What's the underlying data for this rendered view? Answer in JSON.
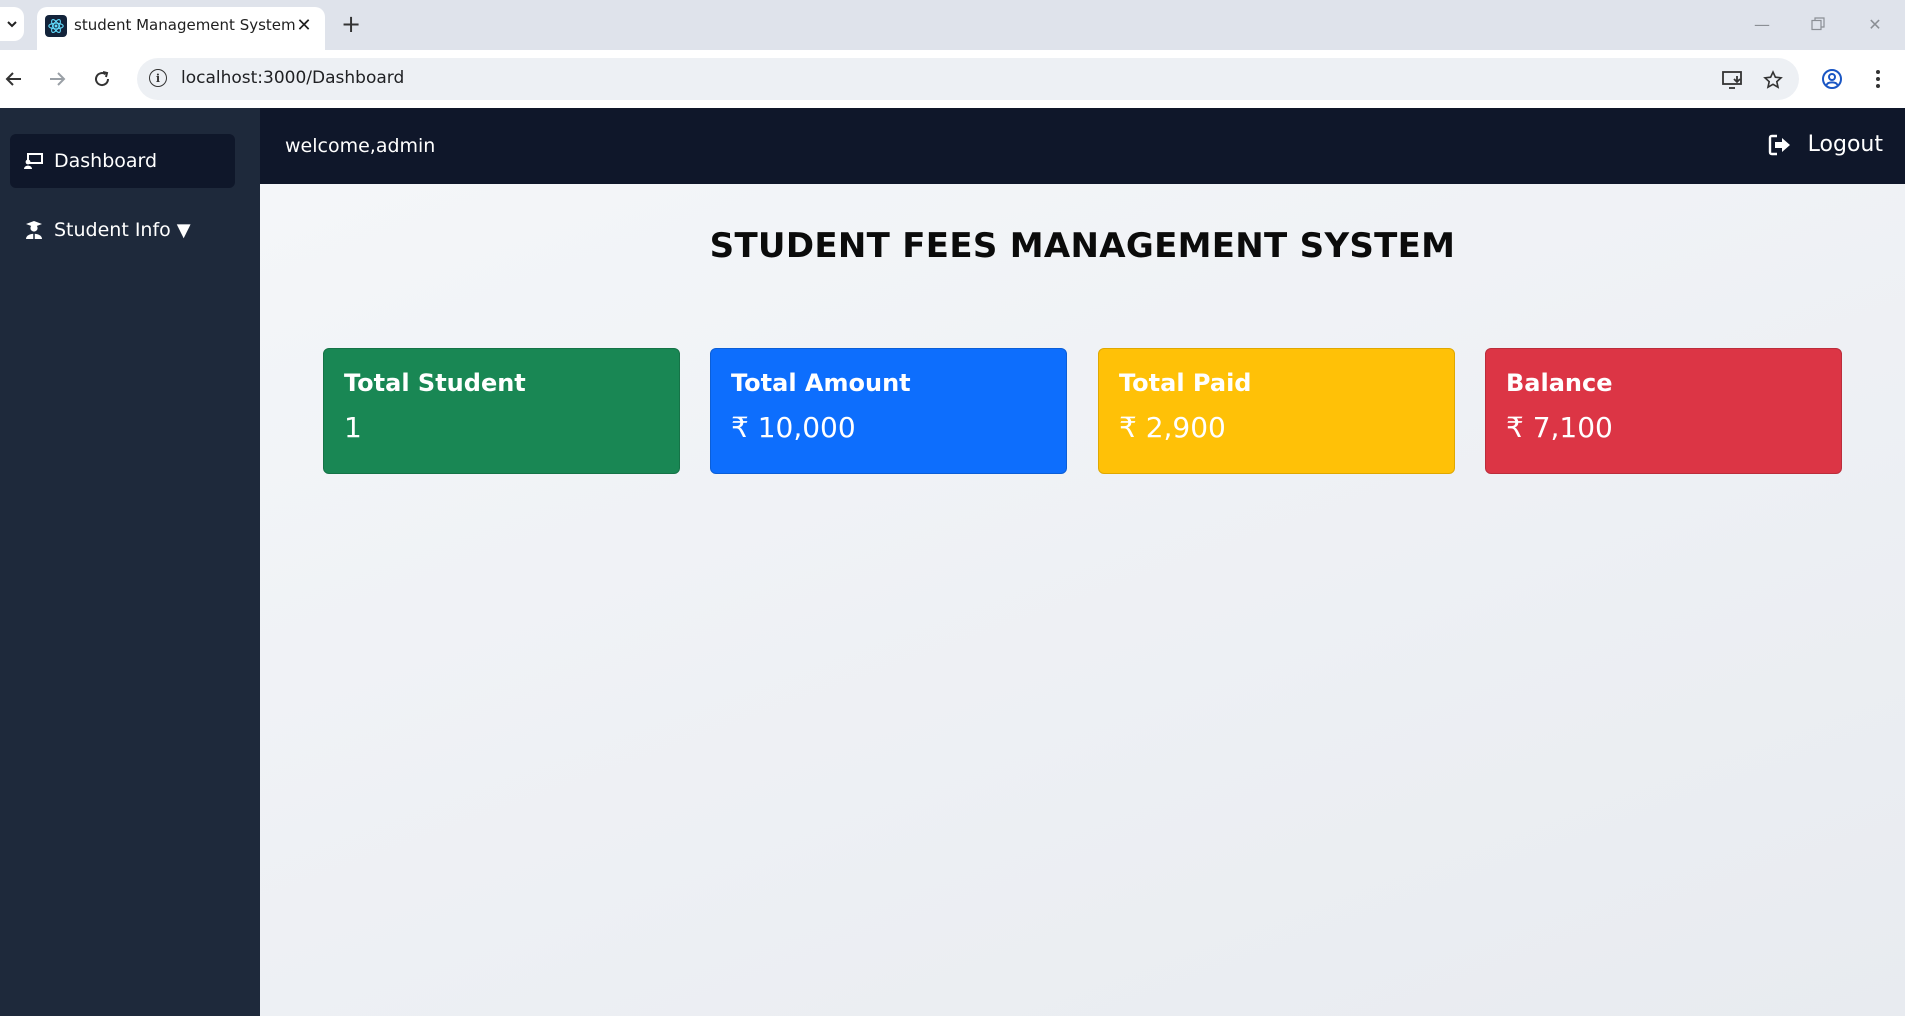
{
  "browser": {
    "tab_title": "student Management System",
    "url": "localhost:3000/Dashboard"
  },
  "sidebar": {
    "items": [
      {
        "label": "Dashboard",
        "icon": "dashboard-icon",
        "active": true
      },
      {
        "label": "Student Info",
        "icon": "student-icon",
        "caret": "▼"
      }
    ]
  },
  "topbar": {
    "welcome": "welcome,admin",
    "logout_label": "Logout"
  },
  "main": {
    "title": "STUDENT FEES MANAGEMENT SYSTEM",
    "cards": [
      {
        "label": "Total Student",
        "value": "1",
        "color": "#198754"
      },
      {
        "label": "Total Amount",
        "value": "₹ 10,000",
        "color": "#0d6efd"
      },
      {
        "label": "Total Paid",
        "value": "₹ 2,900",
        "color": "#ffc107"
      },
      {
        "label": "Balance",
        "value": "₹ 7,100",
        "color": "#dc3545"
      }
    ]
  }
}
